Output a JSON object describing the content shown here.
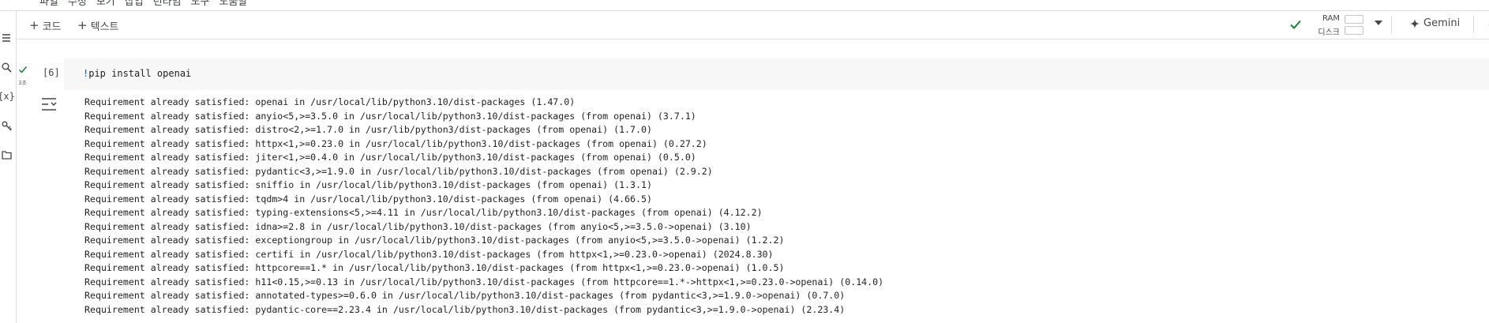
{
  "menubar": {
    "items": [
      "파일",
      "수정",
      "보기",
      "삽입",
      "런타임",
      "도구",
      "도움말"
    ]
  },
  "left_rail": {
    "icons": [
      "menu-icon",
      "search-icon",
      "variables-icon",
      "secrets-key-icon",
      "files-folder-icon"
    ]
  },
  "toolbar": {
    "add_code_label": "코드",
    "add_text_label": "텍스트",
    "ram_label": "RAM",
    "disk_label": "디스크",
    "ram_fill": 0.05,
    "disk_fill": 0.05,
    "gemini_label": "Gemini",
    "accent_color": "#188038"
  },
  "cell": {
    "execution_count": "[6]",
    "runtime": "3초",
    "code_bang": "!",
    "code_text": "pip install openai",
    "output_lines": [
      "Requirement already satisfied: openai in /usr/local/lib/python3.10/dist-packages (1.47.0)",
      "Requirement already satisfied: anyio<5,>=3.5.0 in /usr/local/lib/python3.10/dist-packages (from openai) (3.7.1)",
      "Requirement already satisfied: distro<2,>=1.7.0 in /usr/lib/python3/dist-packages (from openai) (1.7.0)",
      "Requirement already satisfied: httpx<1,>=0.23.0 in /usr/local/lib/python3.10/dist-packages (from openai) (0.27.2)",
      "Requirement already satisfied: jiter<1,>=0.4.0 in /usr/local/lib/python3.10/dist-packages (from openai) (0.5.0)",
      "Requirement already satisfied: pydantic<3,>=1.9.0 in /usr/local/lib/python3.10/dist-packages (from openai) (2.9.2)",
      "Requirement already satisfied: sniffio in /usr/local/lib/python3.10/dist-packages (from openai) (1.3.1)",
      "Requirement already satisfied: tqdm>4 in /usr/local/lib/python3.10/dist-packages (from openai) (4.66.5)",
      "Requirement already satisfied: typing-extensions<5,>=4.11 in /usr/local/lib/python3.10/dist-packages (from openai) (4.12.2)",
      "Requirement already satisfied: idna>=2.8 in /usr/local/lib/python3.10/dist-packages (from anyio<5,>=3.5.0->openai) (3.10)",
      "Requirement already satisfied: exceptiongroup in /usr/local/lib/python3.10/dist-packages (from anyio<5,>=3.5.0->openai) (1.2.2)",
      "Requirement already satisfied: certifi in /usr/local/lib/python3.10/dist-packages (from httpx<1,>=0.23.0->openai) (2024.8.30)",
      "Requirement already satisfied: httpcore==1.* in /usr/local/lib/python3.10/dist-packages (from httpx<1,>=0.23.0->openai) (1.0.5)",
      "Requirement already satisfied: h11<0.15,>=0.13 in /usr/local/lib/python3.10/dist-packages (from httpcore==1.*->httpx<1,>=0.23.0->openai) (0.14.0)",
      "Requirement already satisfied: annotated-types>=0.6.0 in /usr/local/lib/python3.10/dist-packages (from pydantic<3,>=1.9.0->openai) (0.7.0)",
      "Requirement already satisfied: pydantic-core==2.23.4 in /usr/local/lib/python3.10/dist-packages (from pydantic<3,>=1.9.0->openai) (2.23.4)"
    ]
  }
}
